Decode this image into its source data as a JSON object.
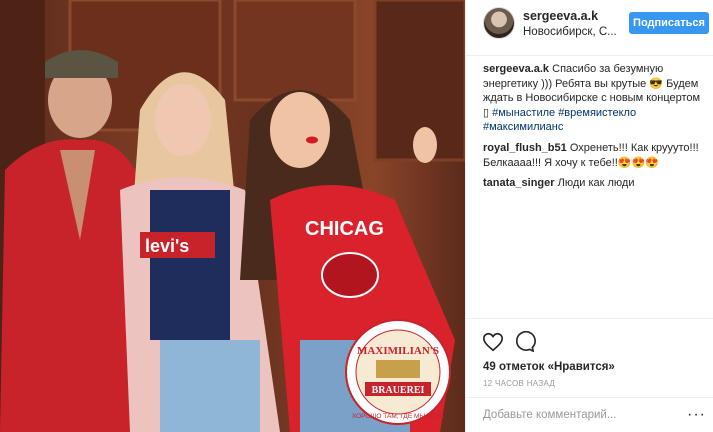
{
  "header": {
    "username": "sergeeva.a.k",
    "location": "Новосибирск, С...",
    "follow_label": "Подписаться"
  },
  "caption": {
    "username": "sergeeva.a.k",
    "text": "Спасибо за безумную энергетику ))) Ребята вы крутые 😎 Будем ждать в Новосибирске с новым концертом ",
    "tags": [
      "#мынастиле",
      "#времяистекло",
      "#максимилианс"
    ]
  },
  "comments": [
    {
      "username": "royal_flush_b51",
      "text": "Охренеть!!! Как круууто!!! Белкаааа!!! Я хочу к тебе!!😍😍😍"
    },
    {
      "username": "tanata_singer",
      "text": "Люди как люди"
    }
  ],
  "actions": {
    "like_icon": "heart-icon",
    "comment_icon": "comment-icon",
    "likes_count": "49 отметок",
    "likes_suffix": "«Нравится»",
    "timestamp": "12 ЧАСОВ НАЗАД",
    "add_comment_placeholder": "Добавьте комментарий...",
    "more_label": "···"
  },
  "photo": {
    "shirt_text": "levi's",
    "sweatshirt_text": "CHICAG",
    "badge_top": "MAXIMILIAN'S",
    "badge_bottom": "BRAUEREI",
    "badge_slogan": "ХОРОШО ТАМ, ГДЕ МЫ ЕСТЬ"
  },
  "colors": {
    "accent": "#3897f0",
    "tag": "#003569"
  }
}
